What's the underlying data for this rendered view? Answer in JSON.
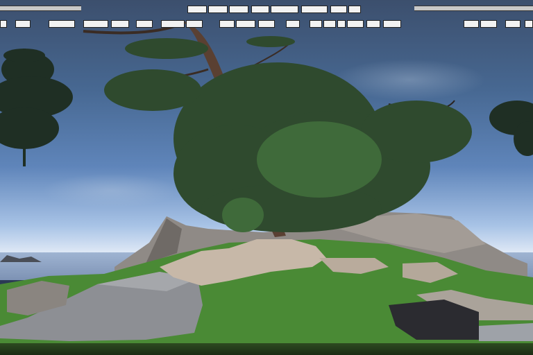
{
  "image": {
    "subject": "",
    "top_labels_row1": [
      "",
      "",
      "",
      "",
      "",
      "",
      "",
      ""
    ],
    "top_labels_row2": [
      "",
      "",
      "",
      "",
      "",
      "",
      "",
      "",
      "",
      "",
      "",
      "",
      "",
      "",
      "",
      "",
      "",
      "",
      ""
    ]
  }
}
